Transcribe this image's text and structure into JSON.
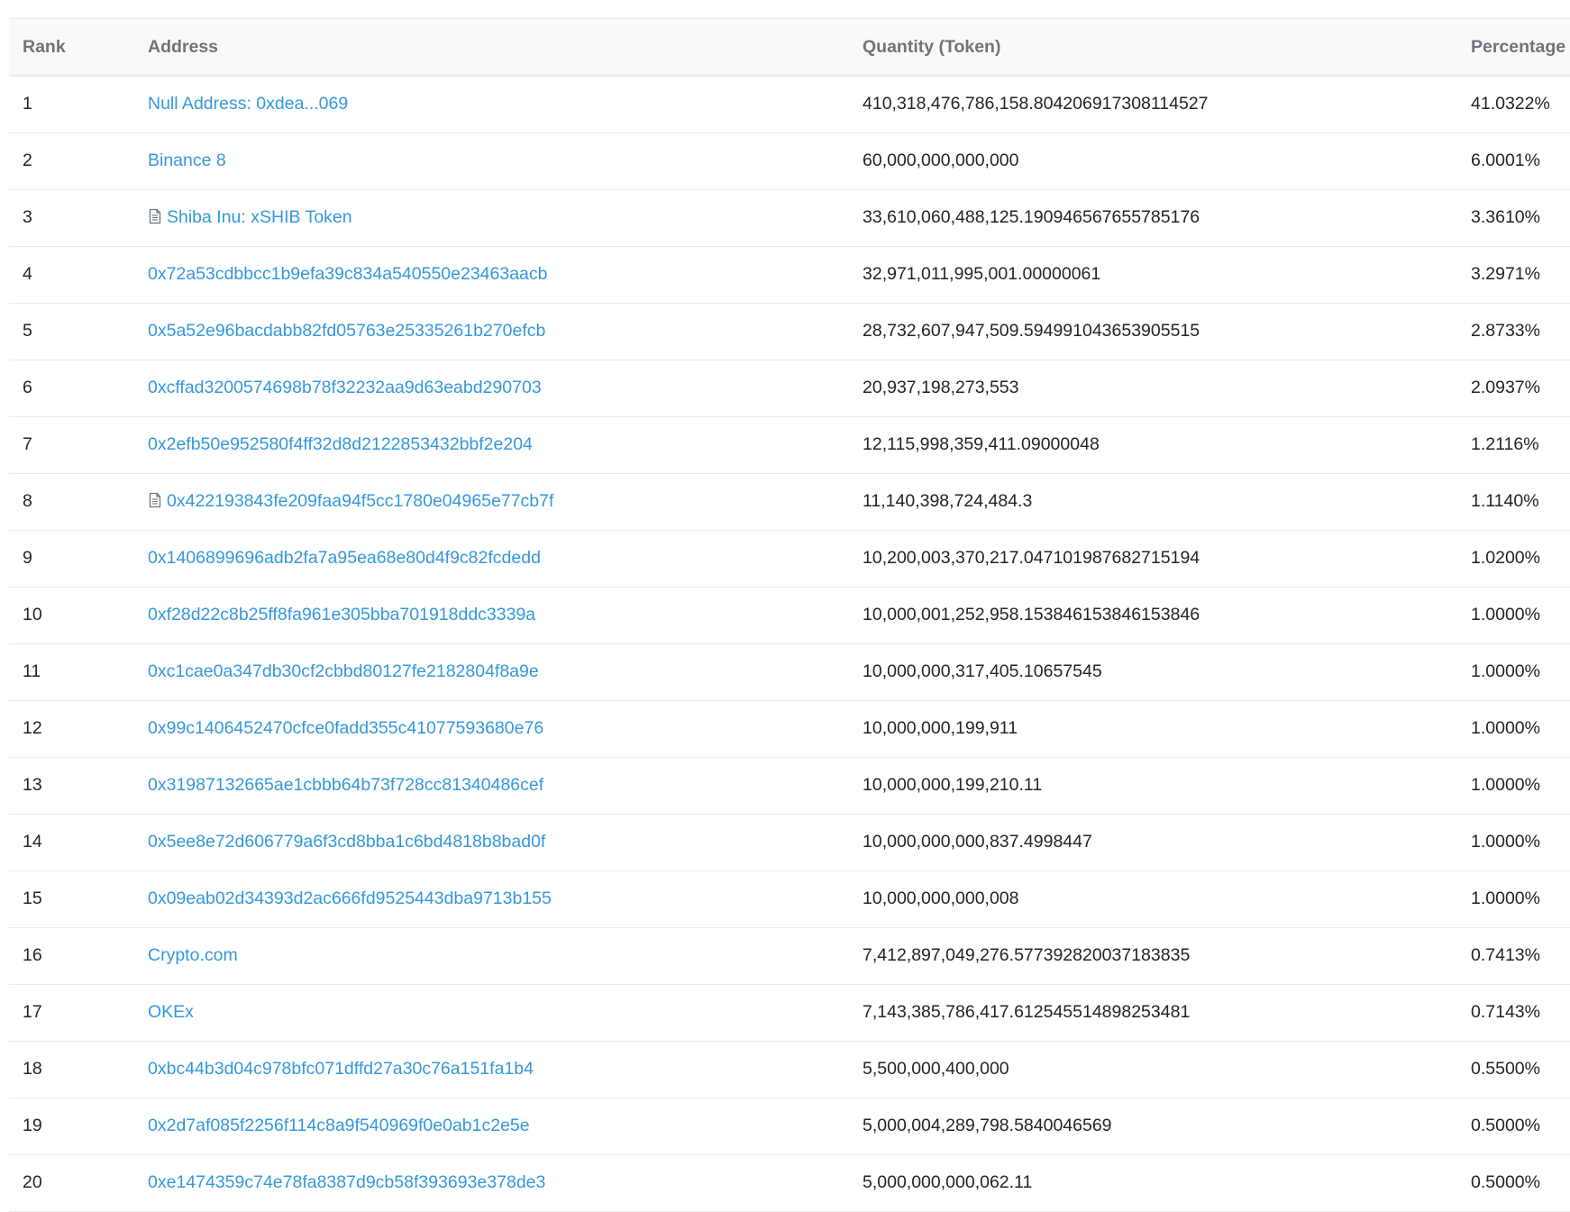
{
  "table": {
    "headers": {
      "rank": "Rank",
      "address": "Address",
      "quantity": "Quantity (Token)",
      "percentage": "Percentage"
    },
    "rows": [
      {
        "rank": "1",
        "address": "Null Address: 0xdea...069",
        "icon": "",
        "quantity": "410,318,476,786,158.804206917308114527",
        "percentage": "41.0322%"
      },
      {
        "rank": "2",
        "address": "Binance 8",
        "icon": "",
        "quantity": "60,000,000,000,000",
        "percentage": "6.0001%"
      },
      {
        "rank": "3",
        "address": "Shiba Inu: xSHIB Token",
        "icon": "contract-document-icon",
        "quantity": "33,610,060,488,125.190946567655785176",
        "percentage": "3.3610%"
      },
      {
        "rank": "4",
        "address": "0x72a53cdbbcc1b9efa39c834a540550e23463aacb",
        "icon": "",
        "quantity": "32,971,011,995,001.00000061",
        "percentage": "3.2971%"
      },
      {
        "rank": "5",
        "address": "0x5a52e96bacdabb82fd05763e25335261b270efcb",
        "icon": "",
        "quantity": "28,732,607,947,509.594991043653905515",
        "percentage": "2.8733%"
      },
      {
        "rank": "6",
        "address": "0xcffad3200574698b78f32232aa9d63eabd290703",
        "icon": "",
        "quantity": "20,937,198,273,553",
        "percentage": "2.0937%"
      },
      {
        "rank": "7",
        "address": "0x2efb50e952580f4ff32d8d2122853432bbf2e204",
        "icon": "",
        "quantity": "12,115,998,359,411.09000048",
        "percentage": "1.2116%"
      },
      {
        "rank": "8",
        "address": "0x422193843fe209faa94f5cc1780e04965e77cb7f",
        "icon": "contract-document-icon",
        "quantity": "11,140,398,724,484.3",
        "percentage": "1.1140%"
      },
      {
        "rank": "9",
        "address": "0x1406899696adb2fa7a95ea68e80d4f9c82fcdedd",
        "icon": "",
        "quantity": "10,200,003,370,217.047101987682715194",
        "percentage": "1.0200%"
      },
      {
        "rank": "10",
        "address": "0xf28d22c8b25ff8fa961e305bba701918ddc3339a",
        "icon": "",
        "quantity": "10,000,001,252,958.153846153846153846",
        "percentage": "1.0000%"
      },
      {
        "rank": "11",
        "address": "0xc1cae0a347db30cf2cbbd80127fe2182804f8a9e",
        "icon": "",
        "quantity": "10,000,000,317,405.10657545",
        "percentage": "1.0000%"
      },
      {
        "rank": "12",
        "address": "0x99c1406452470cfce0fadd355c41077593680e76",
        "icon": "",
        "quantity": "10,000,000,199,911",
        "percentage": "1.0000%"
      },
      {
        "rank": "13",
        "address": "0x31987132665ae1cbbb64b73f728cc81340486cef",
        "icon": "",
        "quantity": "10,000,000,199,210.11",
        "percentage": "1.0000%"
      },
      {
        "rank": "14",
        "address": "0x5ee8e72d606779a6f3cd8bba1c6bd4818b8bad0f",
        "icon": "",
        "quantity": "10,000,000,000,837.4998447",
        "percentage": "1.0000%"
      },
      {
        "rank": "15",
        "address": "0x09eab02d34393d2ac666fd9525443dba9713b155",
        "icon": "",
        "quantity": "10,000,000,000,008",
        "percentage": "1.0000%"
      },
      {
        "rank": "16",
        "address": "Crypto.com",
        "icon": "",
        "quantity": "7,412,897,049,276.577392820037183835",
        "percentage": "0.7413%"
      },
      {
        "rank": "17",
        "address": "OKEx",
        "icon": "",
        "quantity": "7,143,385,786,417.612545514898253481",
        "percentage": "0.7143%"
      },
      {
        "rank": "18",
        "address": "0xbc44b3d04c978bfc071dffd27a30c76a151fa1b4",
        "icon": "",
        "quantity": "5,500,000,400,000",
        "percentage": "0.5500%"
      },
      {
        "rank": "19",
        "address": "0x2d7af085f2256f114c8a9f540969f0e0ab1c2e5e",
        "icon": "",
        "quantity": "5,000,004,289,798.5840046569",
        "percentage": "0.5000%"
      },
      {
        "rank": "20",
        "address": "0xe1474359c74e78fa8387d9cb58f393693e378de3",
        "icon": "",
        "quantity": "5,000,000,000,062.11",
        "percentage": "0.5000%"
      }
    ]
  },
  "colors": {
    "link": "#3498db",
    "header_text": "#6c757d",
    "header_background": "#f8f9fa",
    "row_border": "#e7eaf3",
    "body_text": "#212529"
  }
}
